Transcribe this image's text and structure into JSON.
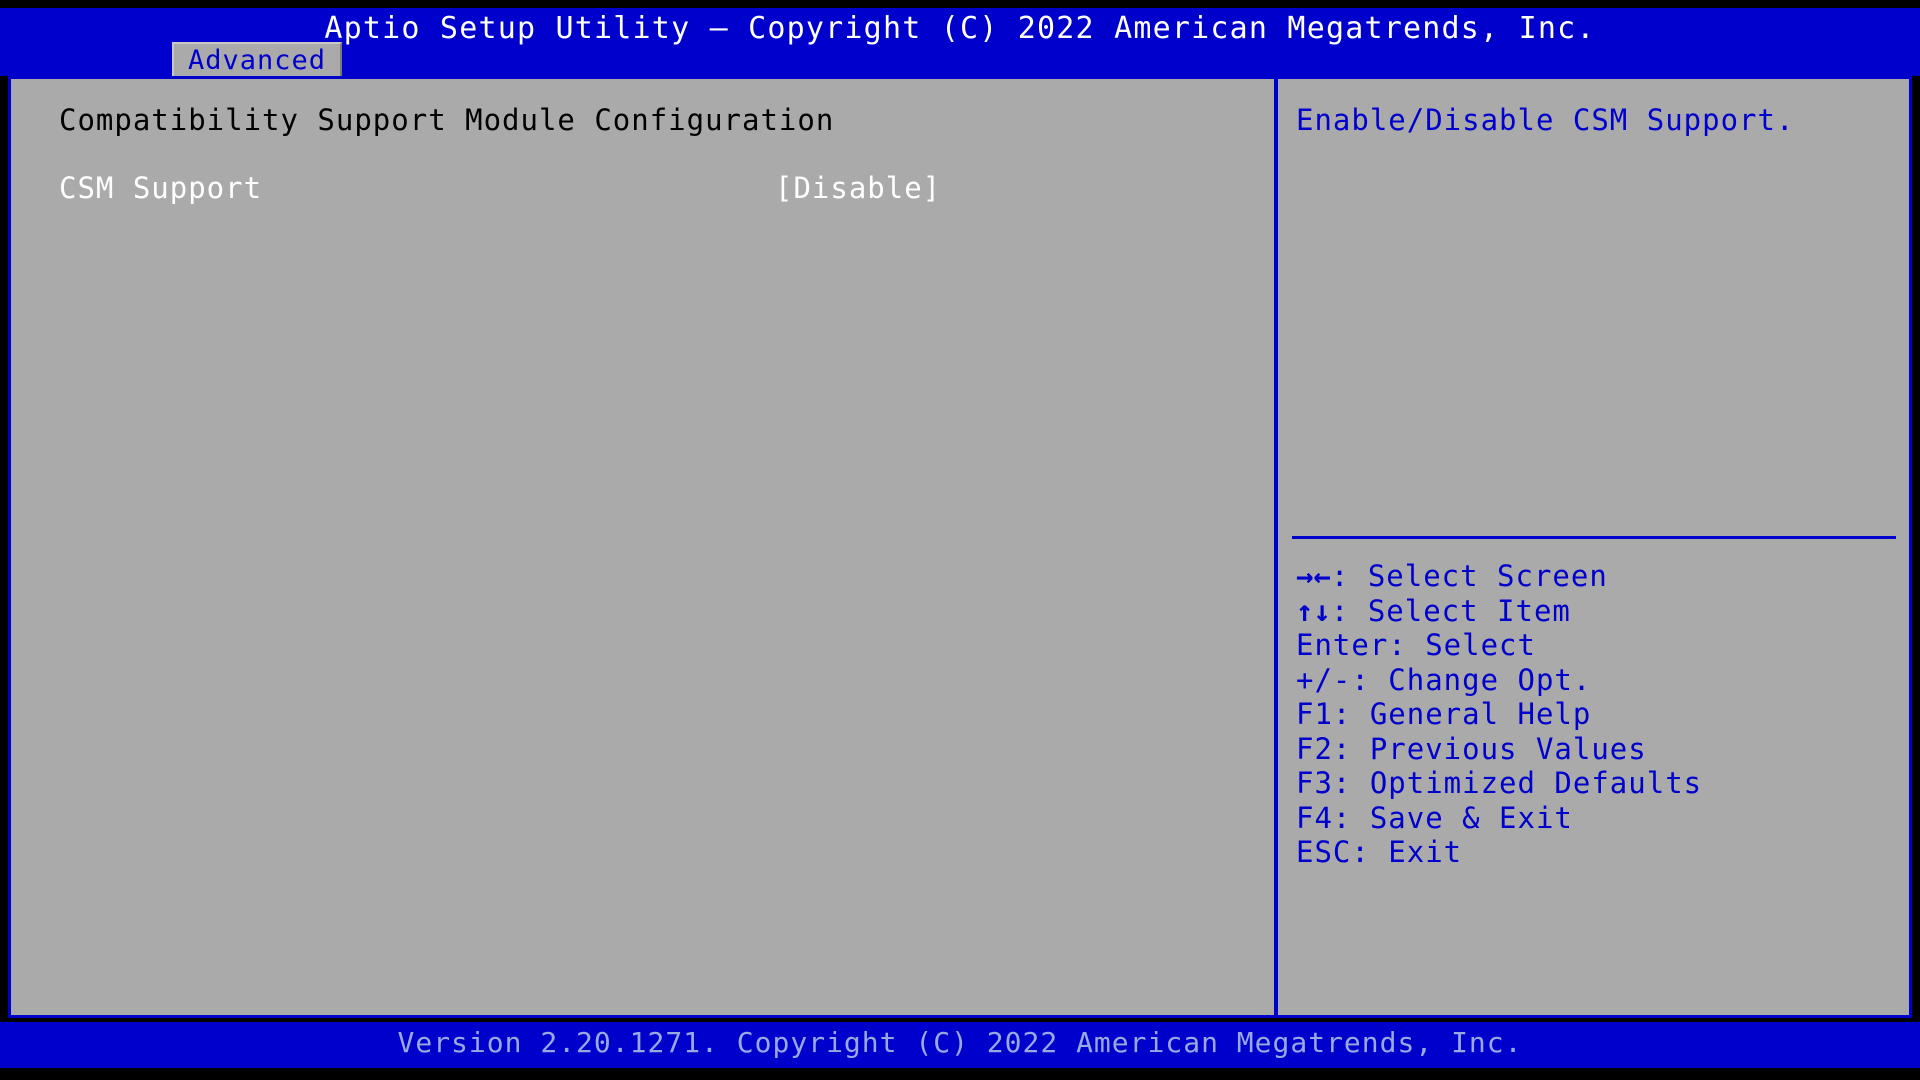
{
  "titlebar": {
    "title": "Aptio Setup Utility – Copyright (C) 2022 American Megatrends, Inc."
  },
  "tabs": [
    {
      "id": "advanced",
      "label": "Advanced",
      "active": true
    }
  ],
  "main": {
    "section_heading": "Compatibility Support Module Configuration",
    "options": [
      {
        "id": "csm-support",
        "label": "CSM Support",
        "value": "[Disable]",
        "selected": true
      }
    ]
  },
  "help": {
    "text": "Enable/Disable CSM Support."
  },
  "keys": [
    {
      "glyph": "→←",
      "text": ": Select Screen"
    },
    {
      "glyph": "↑↓",
      "text": ": Select Item"
    },
    {
      "glyph": "",
      "text": "Enter: Select"
    },
    {
      "glyph": "",
      "text": "+/-: Change Opt."
    },
    {
      "glyph": "",
      "text": "F1: General Help"
    },
    {
      "glyph": "",
      "text": "F2: Previous Values"
    },
    {
      "glyph": "",
      "text": "F3: Optimized Defaults"
    },
    {
      "glyph": "",
      "text": "F4: Save & Exit"
    },
    {
      "glyph": "",
      "text": "ESC: Exit"
    }
  ],
  "footer": {
    "text": "Version 2.20.1271. Copyright (C) 2022 American Megatrends, Inc."
  },
  "colors": {
    "title_bar_bg": "#0000CC",
    "panel_bg": "#AAAAAA",
    "accent_blue": "#0000CC",
    "selected_text": "#FFFFFF",
    "normal_text": "#000000",
    "footer_text": "#9AA8E0"
  }
}
